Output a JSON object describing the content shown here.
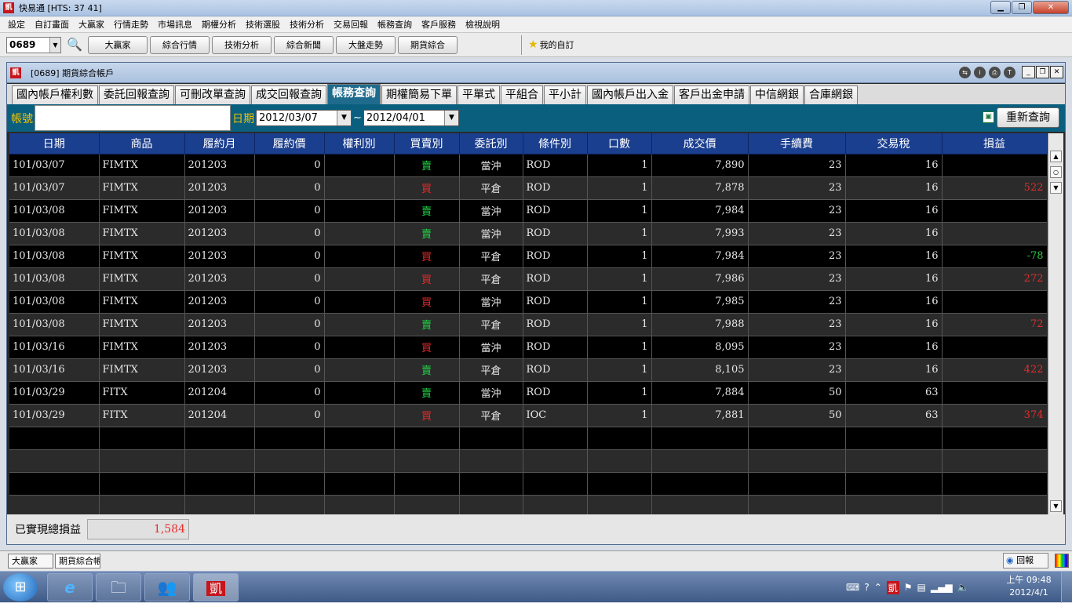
{
  "app": {
    "logo_text": "凱",
    "title": "快易通 [HTS: 37 41]"
  },
  "menu": [
    "設定",
    "自訂畫面",
    "大贏家",
    "行情走勢",
    "市場訊息",
    "期權分析",
    "技術選股",
    "技術分析",
    "交易回報",
    "帳務查詢",
    "客戶服務",
    "檢視說明"
  ],
  "toolbar": {
    "code_value": "0689",
    "buttons": [
      "大贏家",
      "綜合行情",
      "技術分析",
      "綜合新聞",
      "大盤走勢",
      "期貨綜合"
    ],
    "favorites_label": "我的自訂"
  },
  "window": {
    "title": "[0689] 期貨綜合帳戶",
    "tabs": [
      "國內帳戶權利數",
      "委託回報查詢",
      "可刪改單查詢",
      "成交回報查詢",
      "帳務查詢",
      "期權簡易下單",
      "平單式",
      "平組合",
      "平小計",
      "國內帳戶出入金",
      "客戶出金申請",
      "中信網銀",
      "合庫網銀"
    ],
    "active_tab": "帳務查詢"
  },
  "filter": {
    "account_label": "帳號",
    "date_label": "日期",
    "date_from": "2012/03/07",
    "date_to": "2012/04/01",
    "tilde": "~",
    "requery_label": "重新查詢"
  },
  "table": {
    "headers": [
      "日期",
      "商品",
      "履約月",
      "履約價",
      "權利別",
      "買賣別",
      "委託別",
      "條件別",
      "口數",
      "成交價",
      "手續費",
      "交易稅",
      "損益"
    ],
    "rows": [
      {
        "date": "101/03/07",
        "product": "FIMTX",
        "month": "201203",
        "strike": "0",
        "right": "",
        "side": "賣",
        "order": "當沖",
        "cond": "ROD",
        "qty": "1",
        "price": "7,890",
        "fee": "23",
        "tax": "16",
        "pl": ""
      },
      {
        "date": "101/03/07",
        "product": "FIMTX",
        "month": "201203",
        "strike": "0",
        "right": "",
        "side": "買",
        "order": "平倉",
        "cond": "ROD",
        "qty": "1",
        "price": "7,878",
        "fee": "23",
        "tax": "16",
        "pl": "522"
      },
      {
        "date": "101/03/08",
        "product": "FIMTX",
        "month": "201203",
        "strike": "0",
        "right": "",
        "side": "賣",
        "order": "當沖",
        "cond": "ROD",
        "qty": "1",
        "price": "7,984",
        "fee": "23",
        "tax": "16",
        "pl": ""
      },
      {
        "date": "101/03/08",
        "product": "FIMTX",
        "month": "201203",
        "strike": "0",
        "right": "",
        "side": "賣",
        "order": "當沖",
        "cond": "ROD",
        "qty": "1",
        "price": "7,993",
        "fee": "23",
        "tax": "16",
        "pl": ""
      },
      {
        "date": "101/03/08",
        "product": "FIMTX",
        "month": "201203",
        "strike": "0",
        "right": "",
        "side": "買",
        "order": "平倉",
        "cond": "ROD",
        "qty": "1",
        "price": "7,984",
        "fee": "23",
        "tax": "16",
        "pl": "-78"
      },
      {
        "date": "101/03/08",
        "product": "FIMTX",
        "month": "201203",
        "strike": "0",
        "right": "",
        "side": "買",
        "order": "平倉",
        "cond": "ROD",
        "qty": "1",
        "price": "7,986",
        "fee": "23",
        "tax": "16",
        "pl": "272"
      },
      {
        "date": "101/03/08",
        "product": "FIMTX",
        "month": "201203",
        "strike": "0",
        "right": "",
        "side": "買",
        "order": "當沖",
        "cond": "ROD",
        "qty": "1",
        "price": "7,985",
        "fee": "23",
        "tax": "16",
        "pl": ""
      },
      {
        "date": "101/03/08",
        "product": "FIMTX",
        "month": "201203",
        "strike": "0",
        "right": "",
        "side": "賣",
        "order": "平倉",
        "cond": "ROD",
        "qty": "1",
        "price": "7,988",
        "fee": "23",
        "tax": "16",
        "pl": "72"
      },
      {
        "date": "101/03/16",
        "product": "FIMTX",
        "month": "201203",
        "strike": "0",
        "right": "",
        "side": "買",
        "order": "當沖",
        "cond": "ROD",
        "qty": "1",
        "price": "8,095",
        "fee": "23",
        "tax": "16",
        "pl": ""
      },
      {
        "date": "101/03/16",
        "product": "FIMTX",
        "month": "201203",
        "strike": "0",
        "right": "",
        "side": "賣",
        "order": "平倉",
        "cond": "ROD",
        "qty": "1",
        "price": "8,105",
        "fee": "23",
        "tax": "16",
        "pl": "422"
      },
      {
        "date": "101/03/29",
        "product": "FITX",
        "month": "201204",
        "strike": "0",
        "right": "",
        "side": "賣",
        "order": "當沖",
        "cond": "ROD",
        "qty": "1",
        "price": "7,884",
        "fee": "50",
        "tax": "63",
        "pl": ""
      },
      {
        "date": "101/03/29",
        "product": "FITX",
        "month": "201204",
        "strike": "0",
        "right": "",
        "side": "買",
        "order": "平倉",
        "cond": "IOC",
        "qty": "1",
        "price": "7,881",
        "fee": "50",
        "tax": "63",
        "pl": "374"
      }
    ],
    "empty_rows": 4
  },
  "summary": {
    "label": "已實現總損益",
    "value": "1,584"
  },
  "tasks": [
    "大贏家",
    "期貨綜合帳戶"
  ],
  "huibao_label": "回報",
  "clock": {
    "time": "上午 09:48",
    "date": "2012/4/1"
  },
  "colors": {
    "sell": "#22cc44",
    "buy": "#e52c2c",
    "header": "#1b3f8f",
    "filter_bar": "#0a5f7f",
    "active_tab": "#1e6b8e"
  }
}
